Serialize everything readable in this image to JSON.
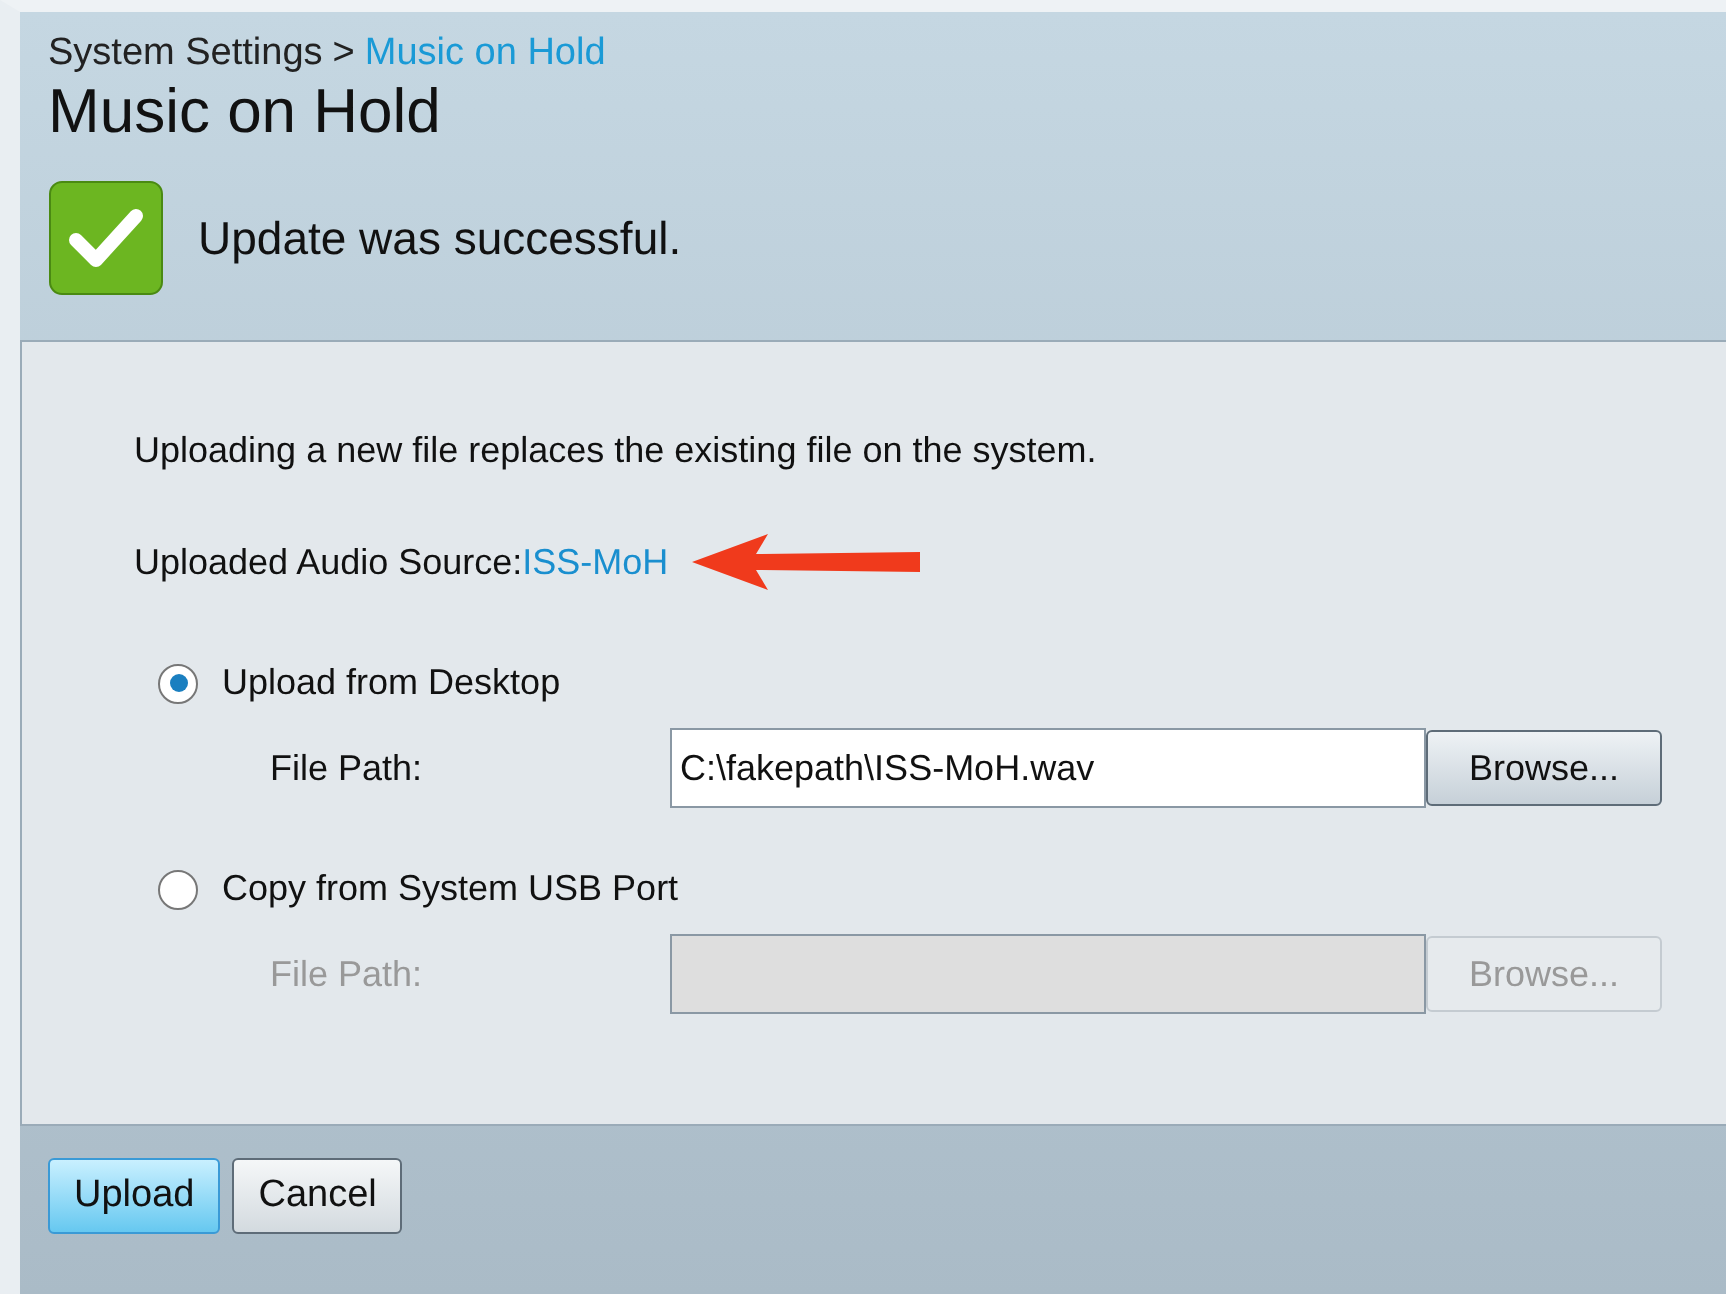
{
  "breadcrumb": {
    "parent": "System Settings",
    "separator": ">",
    "current": "Music on Hold"
  },
  "title": "Music on Hold",
  "alert": {
    "kind": "success",
    "text": "Update was successful."
  },
  "intro": "Uploading a new file replaces the existing file on the system.",
  "audio_source": {
    "label": "Uploaded Audio Source:",
    "value": "ISS-MoH"
  },
  "options": [
    {
      "label": "Upload from Desktop",
      "selected": true,
      "file_path_label": "File Path:",
      "value": "C:\\fakepath\\ISS-MoH.wav",
      "browse": "Browse...",
      "disabled": false
    },
    {
      "label": "Copy from System USB Port",
      "selected": false,
      "file_path_label": "File Path:",
      "browse": "Browse...",
      "disabled": true
    }
  ],
  "buttons": [
    {
      "label": "Upload",
      "primary": true
    },
    {
      "label": "Cancel",
      "primary": false
    }
  ]
}
